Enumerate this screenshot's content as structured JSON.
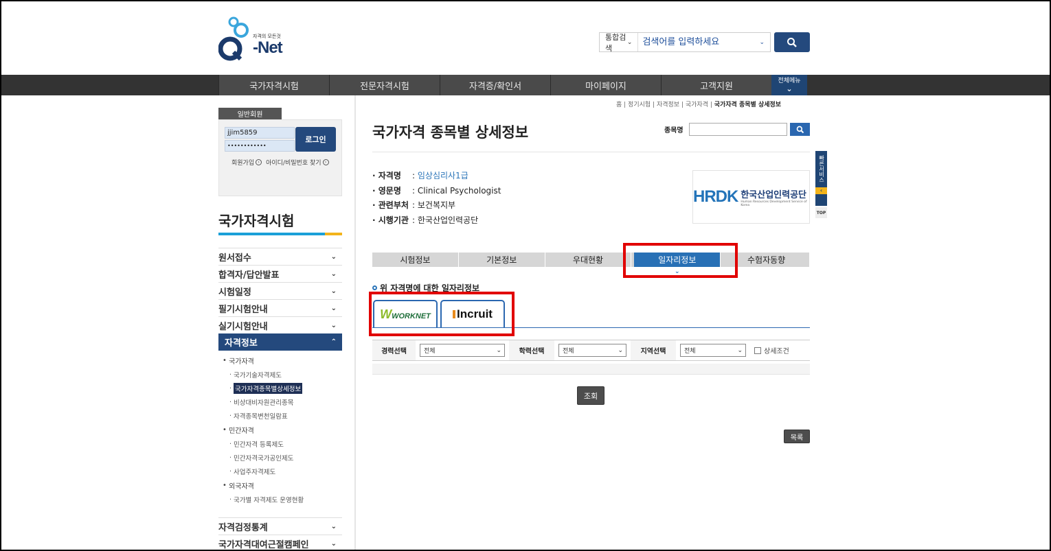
{
  "header": {
    "logo_tagline": "자격의 모든것",
    "logo_word": "-Net",
    "search_scope": "통합검색",
    "search_placeholder": "검색어를 입력하세요"
  },
  "nav": {
    "items": [
      "국가자격시험",
      "전문자격시험",
      "자격증/확인서",
      "마이페이지",
      "고객지원"
    ],
    "all_menu": "전체메뉴"
  },
  "login": {
    "member_tab": "일반회원",
    "user_id": "jjim5859",
    "password_mask": "••••••••••••",
    "login_button": "로그인",
    "signup": "회원가입",
    "find_account": "아이디/비밀번호 찾기"
  },
  "sidebar": {
    "title": "국가자격시험",
    "items": [
      "원서접수",
      "합격자/답안발표",
      "시험일정",
      "필기시험안내",
      "실기시험안내"
    ],
    "active_item": "자격정보",
    "sub": {
      "group1": "국가자격",
      "group1_items": [
        "국가기술자격제도",
        "국가자격종목별상세정보",
        "비상대비자원관리종목",
        "자격종목변천일람표"
      ],
      "group2": "민간자격",
      "group2_items": [
        "민간자격 등록제도",
        "민간자격국가공인제도",
        "사업주자격제도"
      ],
      "group3": "외국자격",
      "group3_items": [
        "국가별 자격제도 운영현황"
      ]
    },
    "bottom_items": [
      "자격검정통계",
      "국가자격대여근절캠페인"
    ]
  },
  "breadcrumb": {
    "items": [
      "홈",
      "정기시험",
      "자격정보",
      "국가자격"
    ],
    "current": "국가자격 종목별 상세정보"
  },
  "page": {
    "title": "국가자격 종목별 상세정보",
    "item_search_label": "종목명"
  },
  "info": {
    "name_label": "자격명",
    "name_value": "임상심리사1급",
    "english_label": "영문명",
    "english_value": "Clinical Psychologist",
    "ministry_label": "관련부처",
    "ministry_value": "보건복지부",
    "agency_label": "시행기관",
    "agency_value": "한국산업인력공단"
  },
  "agency_logo": {
    "mark": "HRDK",
    "name_ko": "한국산업인력공단",
    "name_en": "Human Resources Development Service of Korea"
  },
  "quick_service": {
    "label": "빠른서비스",
    "top": "TOP"
  },
  "tabs": [
    "시험정보",
    "기본정보",
    "우대현황",
    "일자리정보",
    "수험자동향"
  ],
  "active_tab": "일자리정보",
  "job_section": {
    "heading": "위 자격명에 대한 일자리정보",
    "sites": [
      "WORKNET",
      "Incruit"
    ]
  },
  "filters": {
    "career_label": "경력선택",
    "career_value": "전체",
    "education_label": "학력선택",
    "education_value": "전체",
    "region_label": "지역선택",
    "region_value": "전체",
    "detail_label": "상세조건"
  },
  "buttons": {
    "search": "조회",
    "list": "목록"
  },
  "colors": {
    "brand_navy": "#24497d",
    "active_tab": "#2870b5",
    "highlight_red": "#e10000"
  }
}
